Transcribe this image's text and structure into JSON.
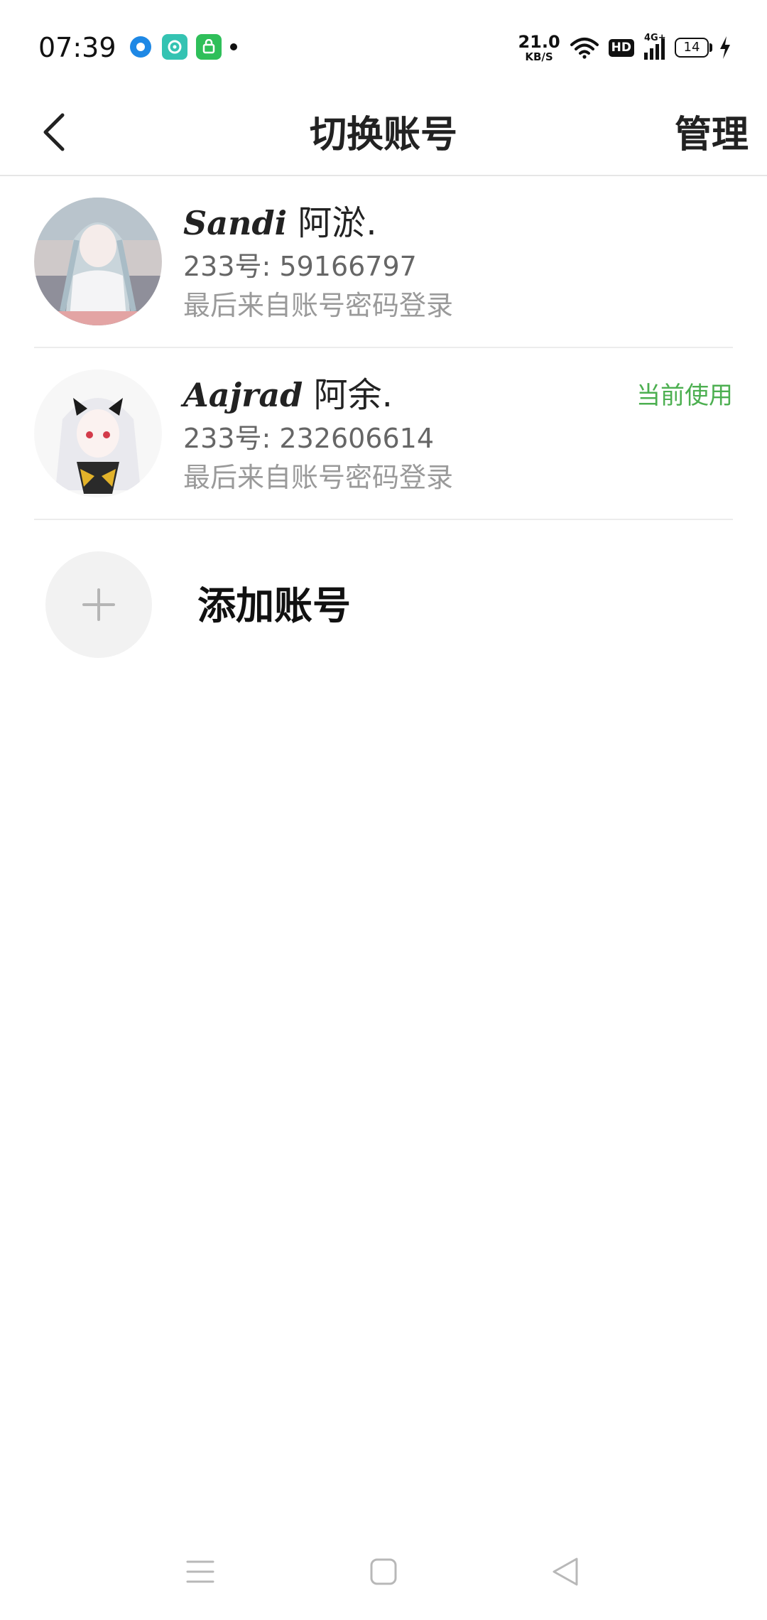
{
  "status_bar": {
    "time": "07:39",
    "net_speed_value": "21.0",
    "net_speed_unit": "KB/S",
    "hd": "HD",
    "signal": "4G+",
    "battery_level": "14",
    "icons": [
      "location-icon",
      "chat-app-icon",
      "store-app-icon",
      "more-dot-icon",
      "wifi-icon",
      "signal-icon",
      "charging-icon"
    ]
  },
  "header": {
    "title": "切换账号",
    "manage_label": "管理",
    "back_icon": "back-arrow-icon"
  },
  "accounts": [
    {
      "name_script": "Sandi",
      "name": "阿淤.",
      "id_text": "233号: 59166797",
      "login_text": "最后来自账号密码登录",
      "current_label": ""
    },
    {
      "name_script": "Aajrad",
      "name": "阿余.",
      "id_text": "233号: 232606614",
      "login_text": "最后来自账号密码登录",
      "current_label": "当前使用"
    }
  ],
  "add_account": {
    "label": "添加账号",
    "icon": "plus-icon"
  },
  "nav": {
    "icons": [
      "menu-icon",
      "home-icon",
      "back-triangle-icon"
    ]
  },
  "colors": {
    "accent_green": "#4caf50",
    "divider": "#ececec",
    "secondary_text": "#666666",
    "tertiary_text": "#9a9a9a"
  }
}
